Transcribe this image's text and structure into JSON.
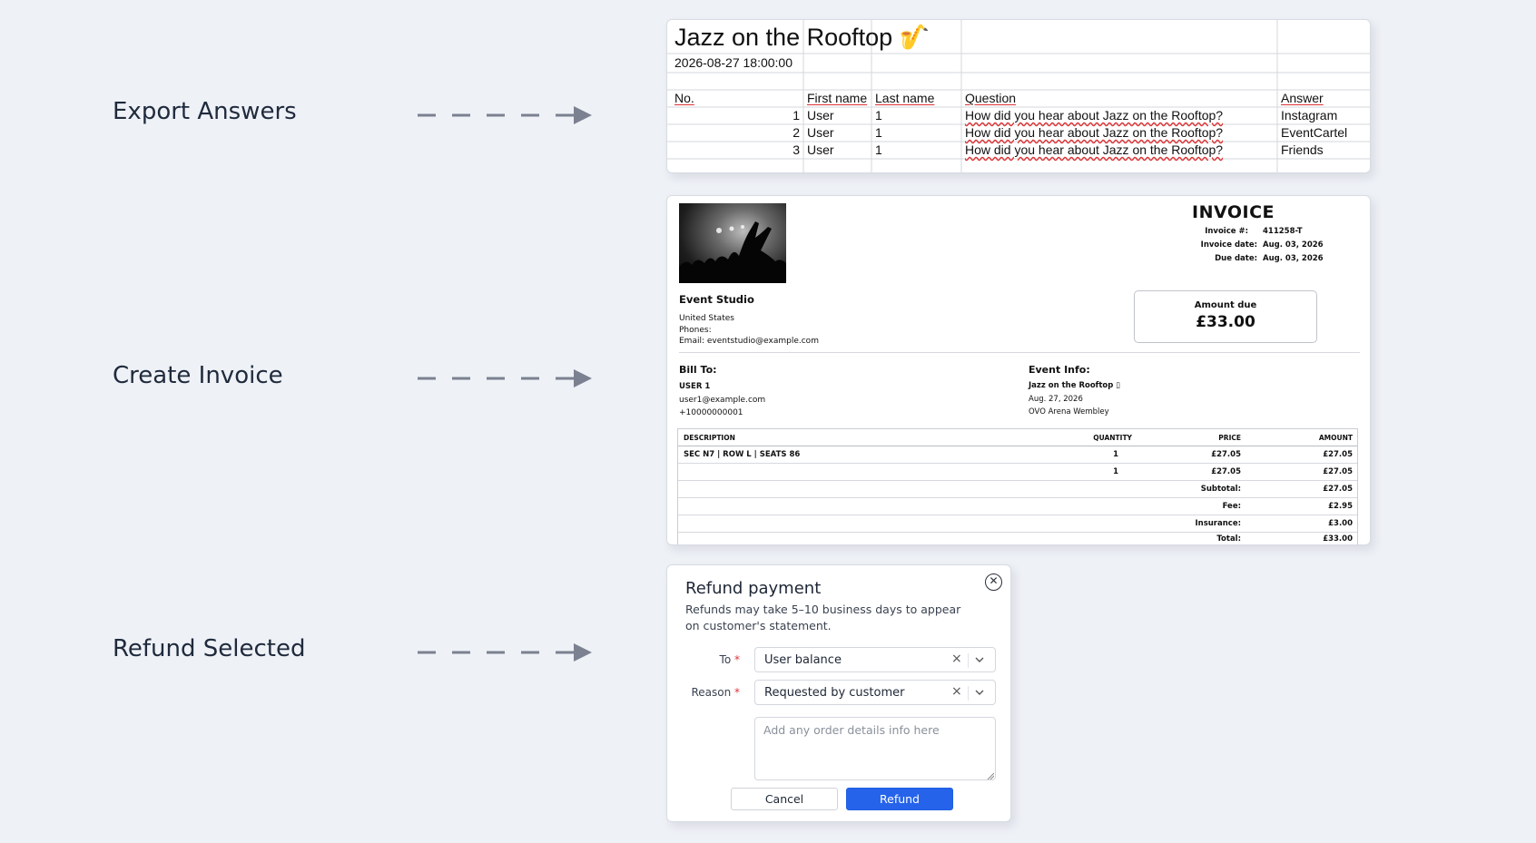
{
  "steps": [
    {
      "label": "Export Answers"
    },
    {
      "label": "Create Invoice"
    },
    {
      "label": "Refund Selected"
    }
  ],
  "sheet": {
    "title": "Jazz on the Rooftop 🎷",
    "datetime": "2026-08-27 18:00:00",
    "headers": {
      "no": "No.",
      "first": "First name",
      "last": "Last name",
      "question": "Question",
      "answer": "Answer"
    },
    "rows": [
      {
        "no": "1",
        "first": "User",
        "last": "1",
        "question": "How did you hear about Jazz on the Rooftop?",
        "answer": "Instagram"
      },
      {
        "no": "2",
        "first": "User",
        "last": "1",
        "question": "How did you hear about Jazz on the Rooftop?",
        "answer": "EventCartel"
      },
      {
        "no": "3",
        "first": "User",
        "last": "1",
        "question": "How did you hear about Jazz on the Rooftop?",
        "answer": "Friends"
      }
    ]
  },
  "invoice": {
    "heading": "INVOICE",
    "meta": {
      "number_label": "Invoice #:",
      "number": "411258-T",
      "date_label": "Invoice date:",
      "date": "Aug. 03, 2026",
      "due_label": "Due date:",
      "due": "Aug. 03, 2026"
    },
    "seller": {
      "name": "Event Studio",
      "country": "United States",
      "phones": "Phones:",
      "email": "Email: eventstudio@example.com"
    },
    "amount_due_label": "Amount due",
    "amount_due": "£33.00",
    "bill_to": {
      "label": "Bill To:",
      "name": "USER 1",
      "email": "user1@example.com",
      "phone": "+10000000001"
    },
    "event_info": {
      "label": "Event Info:",
      "name": "Jazz on the Rooftop ▯",
      "date": "Aug. 27, 2026",
      "venue": "OVO Arena Wembley"
    },
    "table": {
      "headers": {
        "description": "DESCRIPTION",
        "quantity": "QUANTITY",
        "price": "PRICE",
        "amount": "AMOUNT"
      },
      "items": [
        {
          "description": "SEC N7 | ROW L | SEATS 86",
          "quantity": "1",
          "price": "£27.05",
          "amount": "£27.05"
        },
        {
          "description": "",
          "quantity": "1",
          "price": "£27.05",
          "amount": "£27.05"
        }
      ],
      "summary": [
        {
          "label": "Subtotal:",
          "value": "£27.05"
        },
        {
          "label": "Fee:",
          "value": "£2.95"
        },
        {
          "label": "Insurance:",
          "value": "£3.00"
        },
        {
          "label": "Total:",
          "value": "£33.00"
        }
      ]
    }
  },
  "refund": {
    "title": "Refund payment",
    "description": "Refunds may take 5–10 business days to appear on customer's statement.",
    "to_label": "To",
    "to_value": "User balance",
    "reason_label": "Reason",
    "reason_value": "Requested by customer",
    "details_placeholder": "Add any order details info here",
    "cancel_label": "Cancel",
    "refund_label": "Refund",
    "colors": {
      "primary": "#2563eb",
      "required": "#e0303a"
    }
  }
}
